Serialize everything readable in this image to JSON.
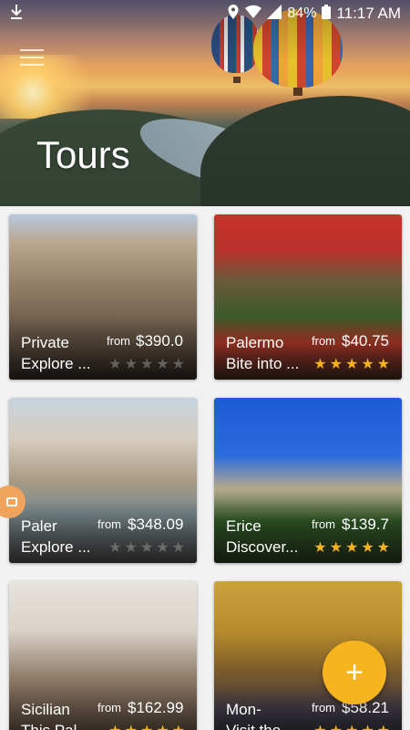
{
  "status_bar": {
    "time": "11:17 AM",
    "battery": "84%"
  },
  "header": {
    "title": "Tours"
  },
  "tours": [
    {
      "name": "Private",
      "desc": "Explore ...",
      "from": "from",
      "price": "$390.0",
      "rating": 0
    },
    {
      "name": "Palermo",
      "desc": "Bite into ...",
      "from": "from",
      "price": "$40.75",
      "rating": 5
    },
    {
      "name": "Paler",
      "desc": "Explore ...",
      "from": "from",
      "price": "$348.09",
      "rating": 0
    },
    {
      "name": "Erice",
      "desc": "Discover...",
      "from": "from",
      "price": "$139.7",
      "rating": 5
    },
    {
      "name": "Sicilian",
      "desc": "This Pal...",
      "from": "from",
      "price": "$162.99",
      "rating": 5
    },
    {
      "name": "Mon-",
      "desc": "Visit the...",
      "from": "from",
      "price": "$58.21",
      "rating": 5
    }
  ],
  "colors": {
    "accent": "#f6b51e",
    "star_active": "#f5b21b"
  },
  "icons": {
    "download": "download-icon",
    "location": "location-icon",
    "wifi": "wifi-icon",
    "signal": "signal-icon",
    "battery": "battery-icon",
    "menu": "menu-icon",
    "fab": "plus-icon"
  },
  "fab": {
    "label": "+"
  }
}
